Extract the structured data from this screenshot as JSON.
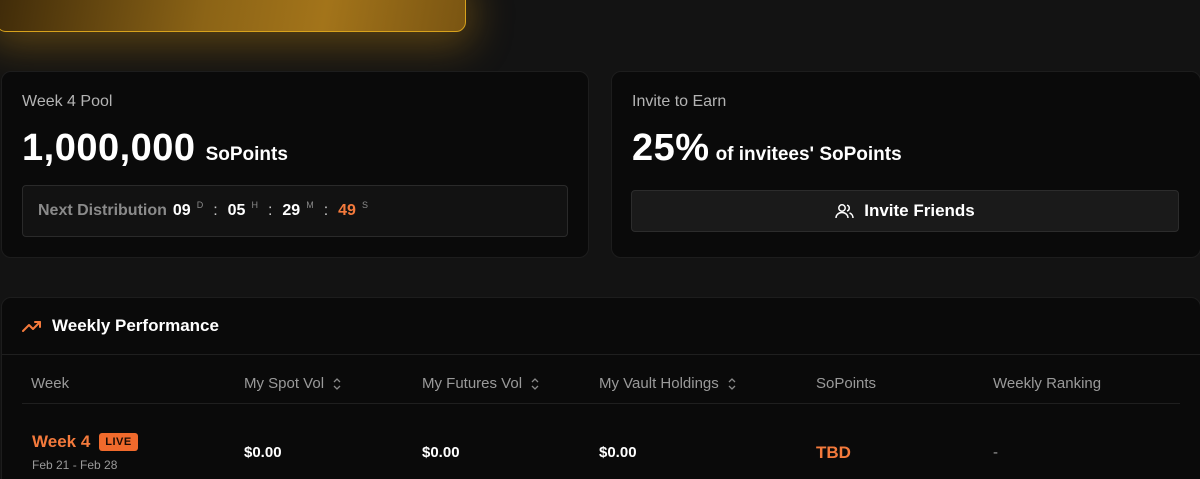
{
  "pool": {
    "label": "Week 4 Pool",
    "amount": "1,000,000",
    "unit": "SoPoints",
    "next_label": "Next Distribution",
    "days": "09",
    "days_unit": "D",
    "hours": "05",
    "hours_unit": "H",
    "minutes": "29",
    "minutes_unit": "M",
    "seconds": "49",
    "seconds_unit": "S"
  },
  "invite": {
    "label": "Invite to Earn",
    "percent": "25%",
    "desc": "of invitees' SoPoints",
    "button_label": "Invite Friends",
    "button_icon": "users-icon"
  },
  "performance": {
    "title": "Weekly Performance",
    "title_icon": "trending-up-icon",
    "columns": [
      "Week",
      "My Spot Vol",
      "My Futures Vol",
      "My Vault Holdings",
      "SoPoints",
      "Weekly Ranking"
    ],
    "rows": [
      {
        "week": "Week 4",
        "badge": "LIVE",
        "dates": "Feb 21 - Feb 28",
        "spot_vol": "$0.00",
        "futures_vol": "$0.00",
        "vault_holdings": "$0.00",
        "sopoints": "TBD",
        "ranking": "-"
      }
    ]
  },
  "colors": {
    "accent": "#f47a3c",
    "gold": "#d8a21c",
    "background": "#131313",
    "card": "#0a0a0a"
  }
}
